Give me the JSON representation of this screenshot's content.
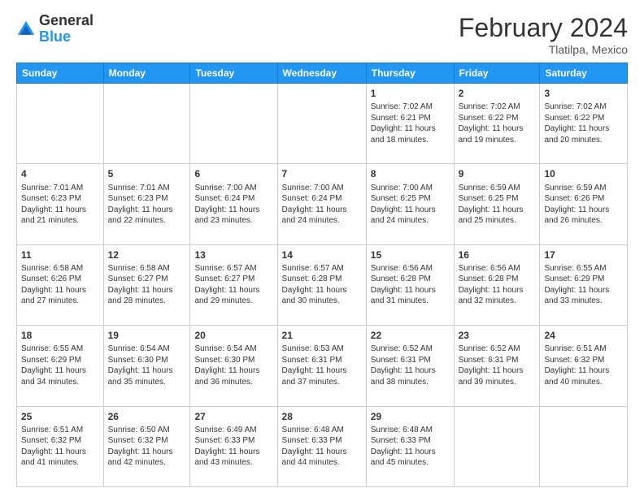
{
  "logo": {
    "general": "General",
    "blue": "Blue"
  },
  "header": {
    "month_year": "February 2024",
    "location": "Tlatilpa, Mexico"
  },
  "days_of_week": [
    "Sunday",
    "Monday",
    "Tuesday",
    "Wednesday",
    "Thursday",
    "Friday",
    "Saturday"
  ],
  "weeks": [
    [
      {
        "day": "",
        "info": ""
      },
      {
        "day": "",
        "info": ""
      },
      {
        "day": "",
        "info": ""
      },
      {
        "day": "",
        "info": ""
      },
      {
        "day": "1",
        "info": "Sunrise: 7:02 AM\nSunset: 6:21 PM\nDaylight: 11 hours and 18 minutes."
      },
      {
        "day": "2",
        "info": "Sunrise: 7:02 AM\nSunset: 6:22 PM\nDaylight: 11 hours and 19 minutes."
      },
      {
        "day": "3",
        "info": "Sunrise: 7:02 AM\nSunset: 6:22 PM\nDaylight: 11 hours and 20 minutes."
      }
    ],
    [
      {
        "day": "4",
        "info": "Sunrise: 7:01 AM\nSunset: 6:23 PM\nDaylight: 11 hours and 21 minutes."
      },
      {
        "day": "5",
        "info": "Sunrise: 7:01 AM\nSunset: 6:23 PM\nDaylight: 11 hours and 22 minutes."
      },
      {
        "day": "6",
        "info": "Sunrise: 7:00 AM\nSunset: 6:24 PM\nDaylight: 11 hours and 23 minutes."
      },
      {
        "day": "7",
        "info": "Sunrise: 7:00 AM\nSunset: 6:24 PM\nDaylight: 11 hours and 24 minutes."
      },
      {
        "day": "8",
        "info": "Sunrise: 7:00 AM\nSunset: 6:25 PM\nDaylight: 11 hours and 24 minutes."
      },
      {
        "day": "9",
        "info": "Sunrise: 6:59 AM\nSunset: 6:25 PM\nDaylight: 11 hours and 25 minutes."
      },
      {
        "day": "10",
        "info": "Sunrise: 6:59 AM\nSunset: 6:26 PM\nDaylight: 11 hours and 26 minutes."
      }
    ],
    [
      {
        "day": "11",
        "info": "Sunrise: 6:58 AM\nSunset: 6:26 PM\nDaylight: 11 hours and 27 minutes."
      },
      {
        "day": "12",
        "info": "Sunrise: 6:58 AM\nSunset: 6:27 PM\nDaylight: 11 hours and 28 minutes."
      },
      {
        "day": "13",
        "info": "Sunrise: 6:57 AM\nSunset: 6:27 PM\nDaylight: 11 hours and 29 minutes."
      },
      {
        "day": "14",
        "info": "Sunrise: 6:57 AM\nSunset: 6:28 PM\nDaylight: 11 hours and 30 minutes."
      },
      {
        "day": "15",
        "info": "Sunrise: 6:56 AM\nSunset: 6:28 PM\nDaylight: 11 hours and 31 minutes."
      },
      {
        "day": "16",
        "info": "Sunrise: 6:56 AM\nSunset: 6:28 PM\nDaylight: 11 hours and 32 minutes."
      },
      {
        "day": "17",
        "info": "Sunrise: 6:55 AM\nSunset: 6:29 PM\nDaylight: 11 hours and 33 minutes."
      }
    ],
    [
      {
        "day": "18",
        "info": "Sunrise: 6:55 AM\nSunset: 6:29 PM\nDaylight: 11 hours and 34 minutes."
      },
      {
        "day": "19",
        "info": "Sunrise: 6:54 AM\nSunset: 6:30 PM\nDaylight: 11 hours and 35 minutes."
      },
      {
        "day": "20",
        "info": "Sunrise: 6:54 AM\nSunset: 6:30 PM\nDaylight: 11 hours and 36 minutes."
      },
      {
        "day": "21",
        "info": "Sunrise: 6:53 AM\nSunset: 6:31 PM\nDaylight: 11 hours and 37 minutes."
      },
      {
        "day": "22",
        "info": "Sunrise: 6:52 AM\nSunset: 6:31 PM\nDaylight: 11 hours and 38 minutes."
      },
      {
        "day": "23",
        "info": "Sunrise: 6:52 AM\nSunset: 6:31 PM\nDaylight: 11 hours and 39 minutes."
      },
      {
        "day": "24",
        "info": "Sunrise: 6:51 AM\nSunset: 6:32 PM\nDaylight: 11 hours and 40 minutes."
      }
    ],
    [
      {
        "day": "25",
        "info": "Sunrise: 6:51 AM\nSunset: 6:32 PM\nDaylight: 11 hours and 41 minutes."
      },
      {
        "day": "26",
        "info": "Sunrise: 6:50 AM\nSunset: 6:32 PM\nDaylight: 11 hours and 42 minutes."
      },
      {
        "day": "27",
        "info": "Sunrise: 6:49 AM\nSunset: 6:33 PM\nDaylight: 11 hours and 43 minutes."
      },
      {
        "day": "28",
        "info": "Sunrise: 6:48 AM\nSunset: 6:33 PM\nDaylight: 11 hours and 44 minutes."
      },
      {
        "day": "29",
        "info": "Sunrise: 6:48 AM\nSunset: 6:33 PM\nDaylight: 11 hours and 45 minutes."
      },
      {
        "day": "",
        "info": ""
      },
      {
        "day": "",
        "info": ""
      }
    ]
  ]
}
